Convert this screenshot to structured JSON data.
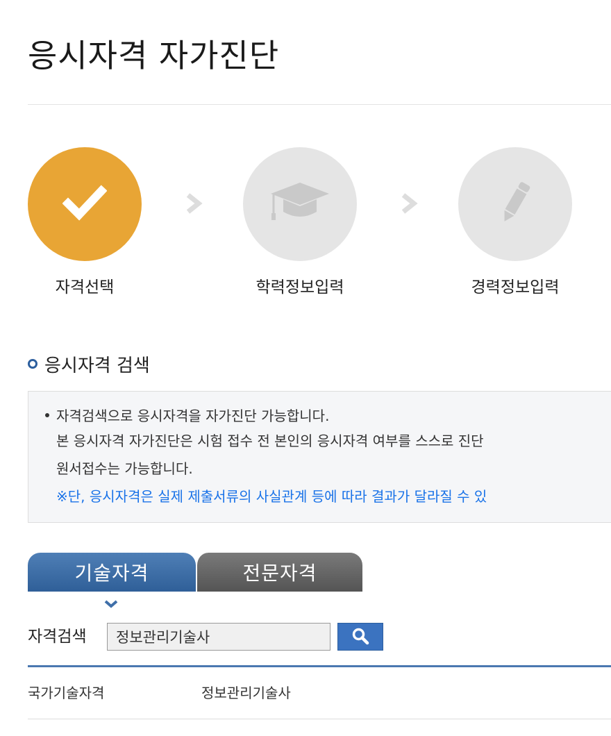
{
  "page": {
    "title": "응시자격 자가진단"
  },
  "steps": [
    {
      "label": "자격선택",
      "icon": "check-icon",
      "state": "active"
    },
    {
      "label": "학력정보입력",
      "icon": "graduation-cap-icon",
      "state": "inactive"
    },
    {
      "label": "경력정보입력",
      "icon": "pencil-icon",
      "state": "inactive"
    }
  ],
  "colors": {
    "active_step": "#e8a535",
    "inactive_step": "#e5e5e5",
    "active_tab": "#3f6fa9",
    "inactive_tab": "#666666",
    "notice_blue": "#1a73e8"
  },
  "search_section": {
    "heading": "응시자격 검색",
    "info": {
      "line1": "자격검색으로 응시자격을 자가진단 가능합니다.",
      "line2": "본 응시자격 자가진단은 시험 접수 전 본인의 응시자격 여부를 스스로 진단",
      "line3": "원서접수는 가능합니다.",
      "line4": "※단, 응시자격은 실제 제출서류의 사실관계 등에 따라 결과가 달라질 수 있"
    },
    "tabs": [
      {
        "label": "기술자격",
        "selected": true
      },
      {
        "label": "전문자격",
        "selected": false
      }
    ],
    "search_label": "자격검색",
    "search_value": "정보관리기술사",
    "search_button_icon": "search-icon"
  },
  "results": [
    {
      "category": "국가기술자격",
      "name": "정보관리기술사"
    }
  ]
}
